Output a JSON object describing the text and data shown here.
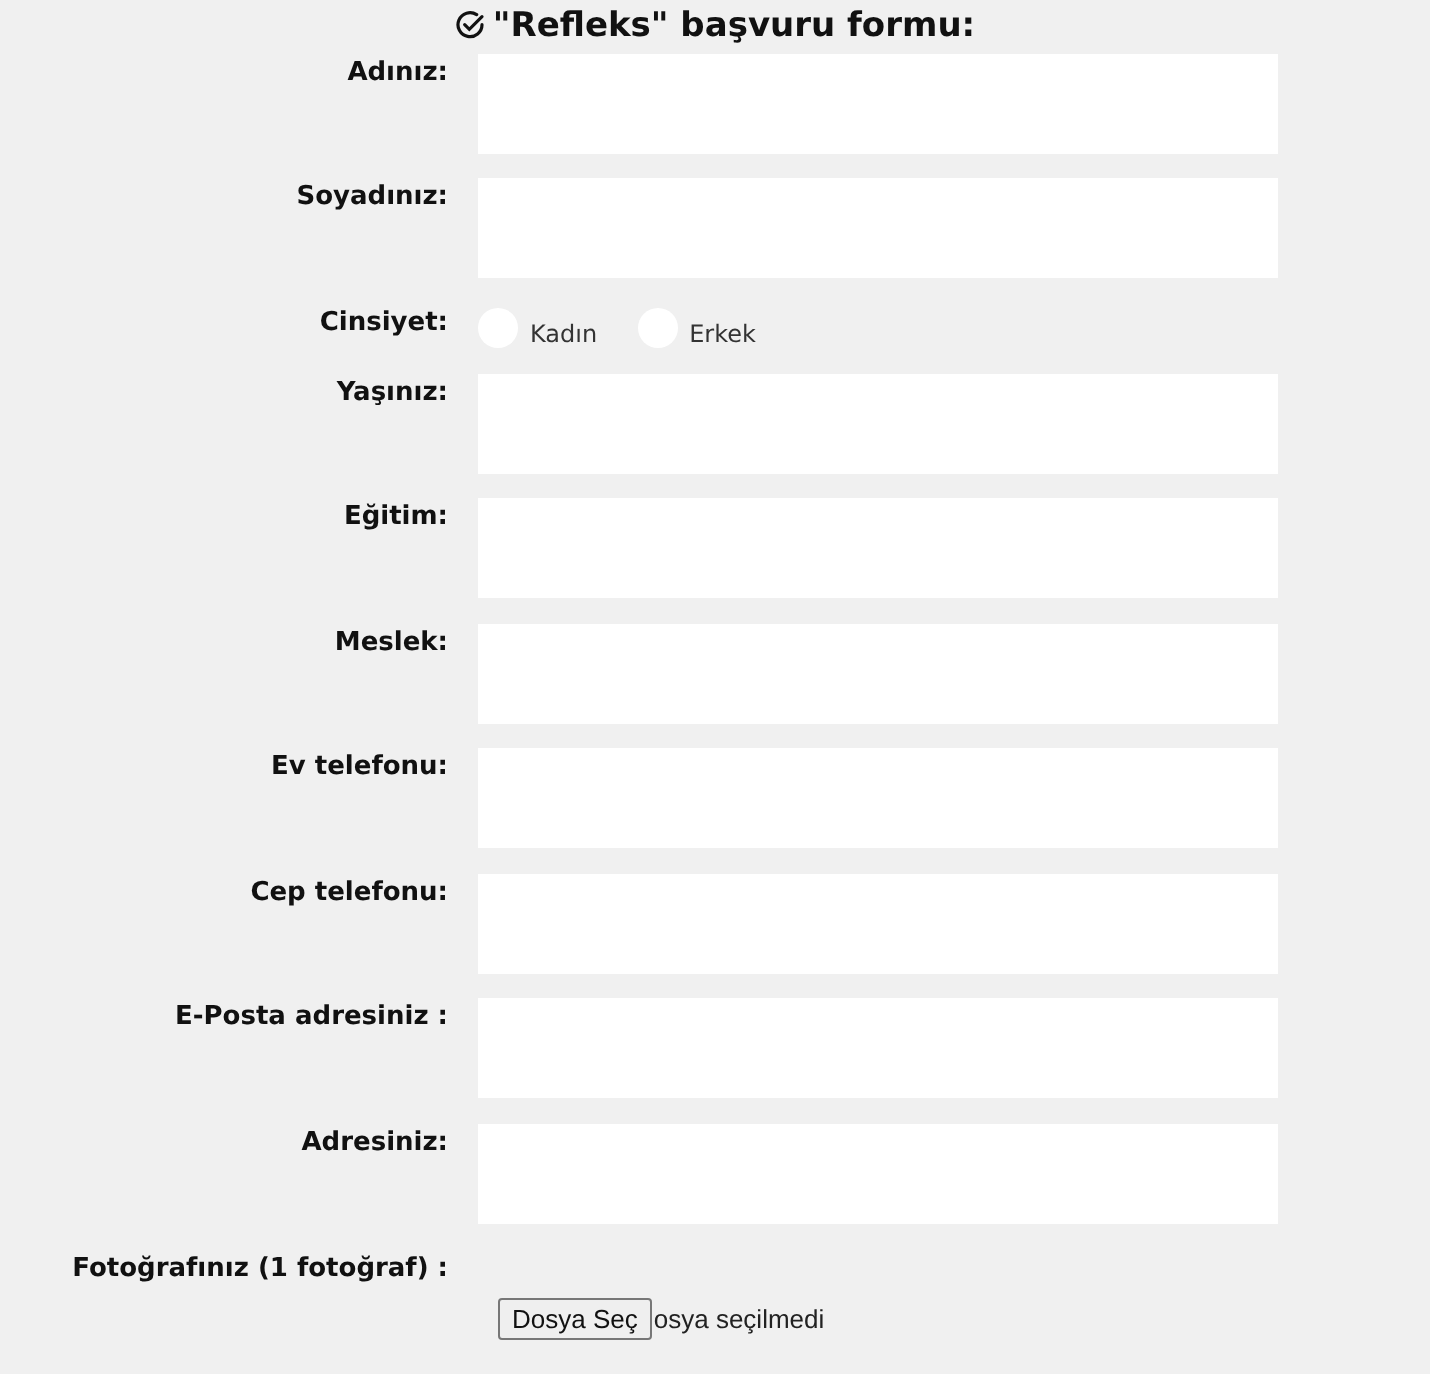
{
  "title": "\"Refleks\" başvuru formu:",
  "fields": [
    {
      "kind": "text",
      "label": "Adınız:"
    },
    {
      "kind": "text",
      "label": "Soyadınız:"
    },
    {
      "kind": "radio",
      "label": "Cinsiyet:",
      "options": [
        {
          "label": "Kadın",
          "selected": false
        },
        {
          "label": "Erkek",
          "selected": false
        }
      ]
    },
    {
      "kind": "text",
      "label": "Yaşınız:"
    },
    {
      "kind": "text",
      "label": "Eğitim:"
    },
    {
      "kind": "text",
      "label": "Meslek:"
    },
    {
      "kind": "text",
      "label": "Ev telefonu:"
    },
    {
      "kind": "text",
      "label": "Cep telefonu:"
    },
    {
      "kind": "text",
      "label": "E-Posta adresiniz :"
    },
    {
      "kind": "text",
      "label": "Adresiniz:"
    },
    {
      "kind": "file",
      "label": "Fotoğrafınız (1 fotoğraf) :",
      "button": "Dosya Seç",
      "status": "osya seçilmedi"
    }
  ]
}
